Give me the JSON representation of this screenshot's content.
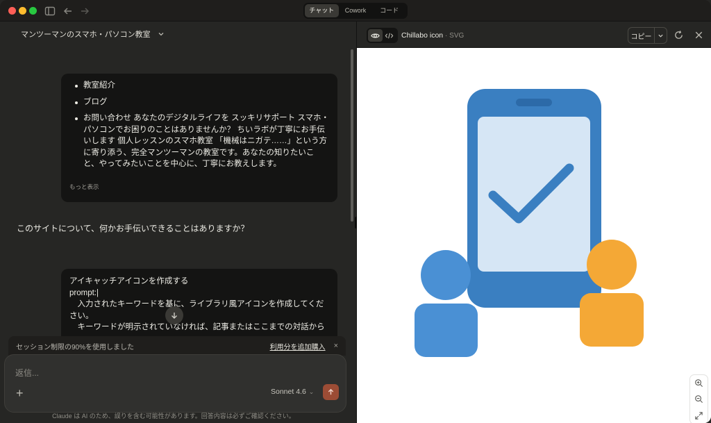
{
  "titlebar": {
    "modes": [
      {
        "label": "チャット",
        "active": true
      },
      {
        "label": "Cowork",
        "active": false
      },
      {
        "label": "コード",
        "active": false
      }
    ]
  },
  "conversation": {
    "title": "マンツーマンのスマホ・パソコン教室",
    "message1": {
      "items": [
        "教室紹介",
        "ブログ",
        "お問い合わせ あなたのデジタルライフを スッキリサポート スマホ・パソコンでお困りのことはありませんか？ ちいラボが丁寧にお手伝いします 個人レッスンのスマホ教室 「機械はニガテ……」という方に寄り添う、完全マンツーマンの教室です。あなたの知りたいこと、やってみたいことを中心に、丁寧にお教えします。"
      ],
      "more": "もっと表示"
    },
    "assistant_reply": "このサイトについて、何かお手伝いできることはありますか？",
    "message2": {
      "lines": [
        "アイキャッチアイコンを作成する",
        "prompt:|",
        "　入力されたキーワードを基に、ライブラリ風アイコンを作成してください。",
        "　キーワードが明示されていなければ、記事またはここまでの対話から"
      ]
    }
  },
  "limit_banner": {
    "text": "セッション制限の90%を使用しました",
    "link": "利用分を追加購入",
    "close": "×"
  },
  "composer": {
    "placeholder": "返信...",
    "model": "Sonnet 4.6"
  },
  "disclaimer": "Claude は AI のため、誤りを含む可能性があります。回答内容は必ずご確認ください。",
  "artifact": {
    "title": "Chillabo icon",
    "type": "· SVG",
    "copy_label": "コピー",
    "colors": {
      "phone": "#3a7fc1",
      "screen": "#d6e6f5",
      "check": "#3a7fc1",
      "person_blue": "#4a90d4",
      "person_orange": "#f4a836"
    }
  }
}
